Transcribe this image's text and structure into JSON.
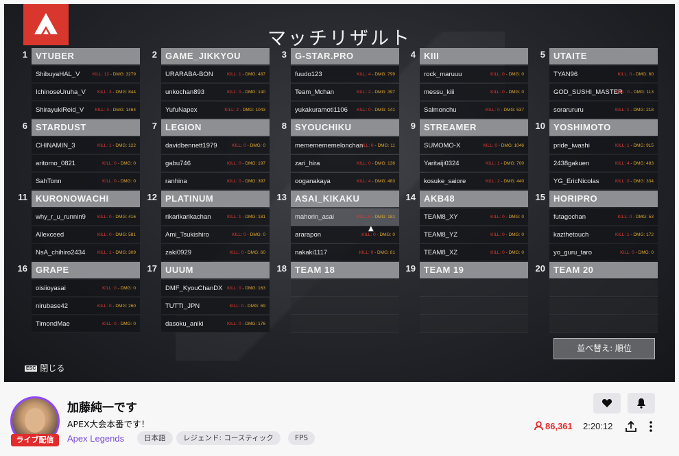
{
  "overlay": {
    "title": "マッチリザルト",
    "esc_key": "ESC",
    "esc_label": "閉じる",
    "sort_button": "並べ替え: 順位",
    "kill_prefix": "KILL",
    "dmg_prefix": "DMG"
  },
  "teams": [
    {
      "num": "1",
      "name": "VTUBER",
      "players": [
        {
          "name": "ShibuyaHAL_V",
          "kill": "12",
          "dmg": "3279"
        },
        {
          "name": "IchinoseUruha_V",
          "kill": "3",
          "dmg": "844"
        },
        {
          "name": "ShirayukiReid_V",
          "kill": "4",
          "dmg": "1464"
        }
      ]
    },
    {
      "num": "2",
      "name": "GAME_JIKKYOU",
      "players": [
        {
          "name": "URARABA-BON",
          "kill": "1",
          "dmg": "487"
        },
        {
          "name": "unkochan893",
          "kill": "0",
          "dmg": "140"
        },
        {
          "name": "YufuNapex",
          "kill": "2",
          "dmg": "1043"
        }
      ]
    },
    {
      "num": "3",
      "name": "G-STAR.PRO",
      "players": [
        {
          "name": "fuudo123",
          "kill": "4",
          "dmg": "799"
        },
        {
          "name": "Team_Mchan",
          "kill": "2",
          "dmg": "397"
        },
        {
          "name": "yukakuramoti1106",
          "kill": "0",
          "dmg": "141"
        }
      ]
    },
    {
      "num": "4",
      "name": "KIII",
      "players": [
        {
          "name": "rock_maruuu",
          "kill": "0",
          "dmg": "0"
        },
        {
          "name": "messu_kiii",
          "kill": "0",
          "dmg": "0"
        },
        {
          "name": "Salmonchu",
          "kill": "0",
          "dmg": "537"
        }
      ]
    },
    {
      "num": "5",
      "name": "UTAITE",
      "players": [
        {
          "name": "TYAN96",
          "kill": "0",
          "dmg": "60"
        },
        {
          "name": "GOD_SUSHI_MASTER",
          "kill": "0",
          "dmg": "113"
        },
        {
          "name": "sorarururu",
          "kill": "1",
          "dmg": "218"
        }
      ]
    },
    {
      "num": "6",
      "name": "STARDUST",
      "players": [
        {
          "name": "CHINAMIN_3",
          "kill": "1",
          "dmg": "122"
        },
        {
          "name": "aritomo_0821",
          "kill": "0",
          "dmg": "0"
        },
        {
          "name": "SahTonn",
          "kill": "0",
          "dmg": "0"
        }
      ]
    },
    {
      "num": "7",
      "name": "LEGION",
      "players": [
        {
          "name": "davidbennett1979",
          "kill": "0",
          "dmg": "0"
        },
        {
          "name": "gabu746",
          "kill": "0",
          "dmg": "197"
        },
        {
          "name": "ranhina",
          "kill": "0",
          "dmg": "397"
        }
      ]
    },
    {
      "num": "8",
      "name": "SYOUCHIKU",
      "players": [
        {
          "name": "mememememelonchan",
          "kill": "0",
          "dmg": "11"
        },
        {
          "name": "zari_hira",
          "kill": "0",
          "dmg": "136"
        },
        {
          "name": "ooganakaya",
          "kill": "4",
          "dmg": "483"
        }
      ]
    },
    {
      "num": "9",
      "name": "STREAMER",
      "players": [
        {
          "name": "SUMOMO-X",
          "kill": "0",
          "dmg": "1046"
        },
        {
          "name": "Yaritaiji0324",
          "kill": "1",
          "dmg": "700"
        },
        {
          "name": "kosuke_saiore",
          "kill": "2",
          "dmg": "440"
        }
      ]
    },
    {
      "num": "10",
      "name": "YOSHIMOTO",
      "players": [
        {
          "name": "pride_iwashi",
          "kill": "1",
          "dmg": "915"
        },
        {
          "name": "2438gakuen",
          "kill": "4",
          "dmg": "483"
        },
        {
          "name": "YG_EricNicolas",
          "kill": "0",
          "dmg": "334"
        }
      ]
    },
    {
      "num": "11",
      "name": "KURONOWACHI",
      "players": [
        {
          "name": "why_r_u_runnin9",
          "kill": "0",
          "dmg": "416"
        },
        {
          "name": "Allexceed",
          "kill": "0",
          "dmg": "581"
        },
        {
          "name": "NsA_chihiro2434",
          "kill": "1",
          "dmg": "309"
        }
      ]
    },
    {
      "num": "12",
      "name": "PLATINUM",
      "players": [
        {
          "name": "rikarikarikachan",
          "kill": "1",
          "dmg": "181"
        },
        {
          "name": "Ami_Tsukishiro",
          "kill": "0",
          "dmg": "0"
        },
        {
          "name": "zaki0929",
          "kill": "0",
          "dmg": "60"
        }
      ]
    },
    {
      "num": "13",
      "name": "ASAI_KIKAKU",
      "players": [
        {
          "name": "mahorin_asai",
          "kill": "0",
          "dmg": "181",
          "highlight": true
        },
        {
          "name": "ararapon",
          "kill": "0",
          "dmg": "0"
        },
        {
          "name": "nakaki1117",
          "kill": "0",
          "dmg": "81"
        }
      ]
    },
    {
      "num": "14",
      "name": "AKB48",
      "players": [
        {
          "name": "TEAM8_XY",
          "kill": "0",
          "dmg": "0"
        },
        {
          "name": "TEAM8_YZ",
          "kill": "0",
          "dmg": "0"
        },
        {
          "name": "TEAM8_XZ",
          "kill": "0",
          "dmg": "0"
        }
      ]
    },
    {
      "num": "15",
      "name": "HORIPRO",
      "players": [
        {
          "name": "futagochan",
          "kill": "0",
          "dmg": "53"
        },
        {
          "name": "kazthetouch",
          "kill": "1",
          "dmg": "172"
        },
        {
          "name": "yo_guru_taro",
          "kill": "0",
          "dmg": "0"
        }
      ]
    },
    {
      "num": "16",
      "name": "GRAPE",
      "players": [
        {
          "name": "oisiioyasai",
          "kill": "0",
          "dmg": "0"
        },
        {
          "name": "nirubase42",
          "kill": "0",
          "dmg": "260"
        },
        {
          "name": "TimondMae",
          "kill": "0",
          "dmg": "0"
        }
      ]
    },
    {
      "num": "17",
      "name": "UUUM",
      "players": [
        {
          "name": "DMF_KyouChanDX",
          "kill": "0",
          "dmg": "163"
        },
        {
          "name": "TUTTI_JPN",
          "kill": "0",
          "dmg": "69"
        },
        {
          "name": "dasoku_aniki",
          "kill": "0",
          "dmg": "176"
        }
      ]
    },
    {
      "num": "18",
      "name": "TEAM 18",
      "players": []
    },
    {
      "num": "19",
      "name": "TEAM 19",
      "players": []
    },
    {
      "num": "20",
      "name": "TEAM 20",
      "players": []
    }
  ],
  "stream": {
    "channel_name": "加藤純一です",
    "title": "APEX大会本番です！",
    "game": "Apex Legends",
    "live_badge": "ライブ配信",
    "tags": [
      "日本語",
      "レジェンド: コースティック",
      "FPS"
    ],
    "viewers": "86,361",
    "uptime": "2:20:12",
    "accent_color": "#9147ff",
    "live_color": "#e02c2c"
  }
}
